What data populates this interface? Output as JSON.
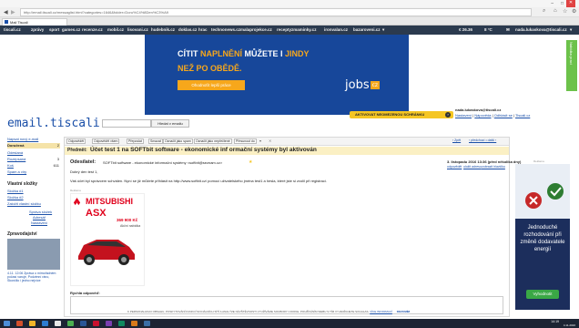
{
  "browser": {
    "url": "http://email.tiscali.cz/messaglist.html?categories=1646&folder=Doru%C4%8Den%C3%A9",
    "tab_title": "Mail Tiscali",
    "window_controls": [
      "–",
      "□",
      "✕"
    ]
  },
  "topmenu": {
    "items": [
      "tiscali.cz",
      "zprávy",
      "sport",
      "games.cz",
      "recenze.cz",
      "mobil.cz",
      "lisovani.cz",
      "hudebnik.cz",
      "doklas.cz",
      "hrac",
      "technonews.cz",
      "malaprojekce.cz",
      "receptyzmaminky.cz",
      "ironvalan.cz",
      "bazaroveni.cz"
    ],
    "weather": "€ 26.36",
    "temp": "8 °C",
    "user": "nada.lukaskova@tiscali.cz"
  },
  "banner": {
    "line1_a": "CÍTIT ",
    "line1_b": "NAPLNĚNÍ",
    "line1_c": " MŮŽETE I ",
    "line1_d": "JINDY",
    "line2": "NEŽ PO OBĚDĚ.",
    "button": "Ohodnoťit lepší práce",
    "logo": "jobs",
    "logo_suffix": "cz",
    "side_label": "Nabídka prací"
  },
  "header": {
    "logo": "email.tiscali.cz",
    "search_placeholder": "",
    "search_button": "Hledat v emailu",
    "activate_button": "AKTIVOVAT NEOMEZENOU SCHRÁNKU",
    "user_email": "nada.lukaskova@tiscali.cz",
    "links": [
      "Nastavení",
      "Nápověda",
      "Odhlásit se",
      "Tiscali.cz"
    ]
  },
  "sidebar": {
    "new_mail": "Napsat nový e-mail",
    "folders": [
      {
        "label": "Doručená",
        "count": "2"
      },
      {
        "label": "Odeslaná",
        "count": ""
      },
      {
        "label": "Rozepsaná",
        "count": "3"
      },
      {
        "label": "Koš",
        "count": "611"
      },
      {
        "label": "Spam a viry",
        "count": ""
      }
    ],
    "own_title": "Vlastní složky",
    "own": [
      "Složka #1",
      "Složka #2",
      "Založit vlastní složku"
    ],
    "manage": "Správa složek",
    "manage2": "Adresář",
    "manage3": "Nastavení",
    "news_title": "Zpravodajství",
    "news_caption": "4.11. 12:06 Zpráva o mimořádném počasí varuje, Podzimní ráno, Skončilo i jedno nejvíce"
  },
  "toolbar": {
    "buttons": [
      "Odpovědět",
      "Odpovědět všem",
      "Přeposlat",
      "Smazat",
      "Označit jako spam",
      "Označit jako nepřečtené",
      "Přesunout do"
    ],
    "back": "‹ Zpět",
    "prev_next": "‹ předchozí • další ›"
  },
  "message": {
    "subject_label": "Předmět:",
    "subject": "Účet test 1 na SOFTbit software - ekonomické inf ormační systémy byl aktivován",
    "from_label": "Odesílatel:",
    "from": "SOFTbit software - ekonomické informační systémy <softbit@seznam.cz>",
    "date": "3. listopadu 2016 13:36 (před několika dny)",
    "actions": [
      "odpovědět",
      "uložit adresu",
      "zobrazit hlavičku"
    ],
    "body_greeting": "Dobrý den test 1,",
    "body_text": "Váš účet byl správcem schválen. Nyní se již můžete přihlásit na http://www.softbit.cz/ pomocí uživatelského jména test1 a hesla, které jste si zvolil při registraci.",
    "ad_label": "Reklama",
    "ad_brand": "MITSUBISHI",
    "ad_model": "ASX",
    "ad_price": "369 900 Kč",
    "ad_price_note": "Akční nabídka",
    "quick_reply": "Rychlá odpověď:",
    "footer_text": "K PERSONALIZACI OBSAHU, POSKYTOVÁNÍ FUNKCÍ SOCIÁLNÍCH SÍTÍ A ANALÝZE NÁVŠTĚVNOSTI VYUŽÍVÁME SOUBORY COOKIE. POUŽÍVÁNÍM WEBU S TÍM VYJADŘUJETE SOUHLAS.",
    "footer_link": "VÍCE INFORMACÍ",
    "footer_ok": "ROZUMÍM"
  },
  "rightad": {
    "label": "Reklama",
    "text": "Jednoduché rozhodování při změně dodavatele energií",
    "button": "Vyhodnotit"
  },
  "taskbar": {
    "time": "14:19",
    "date": "4.11.2016"
  },
  "colors": {
    "banner_bg": "#17479a",
    "banner_accent": "#f7a71b",
    "brand_blue": "#1a4fa8",
    "activate_bg": "#f5c623",
    "ad_red": "#e0001b",
    "rightad_bg": "#1c2e5c",
    "green_btn": "#3aa845"
  }
}
